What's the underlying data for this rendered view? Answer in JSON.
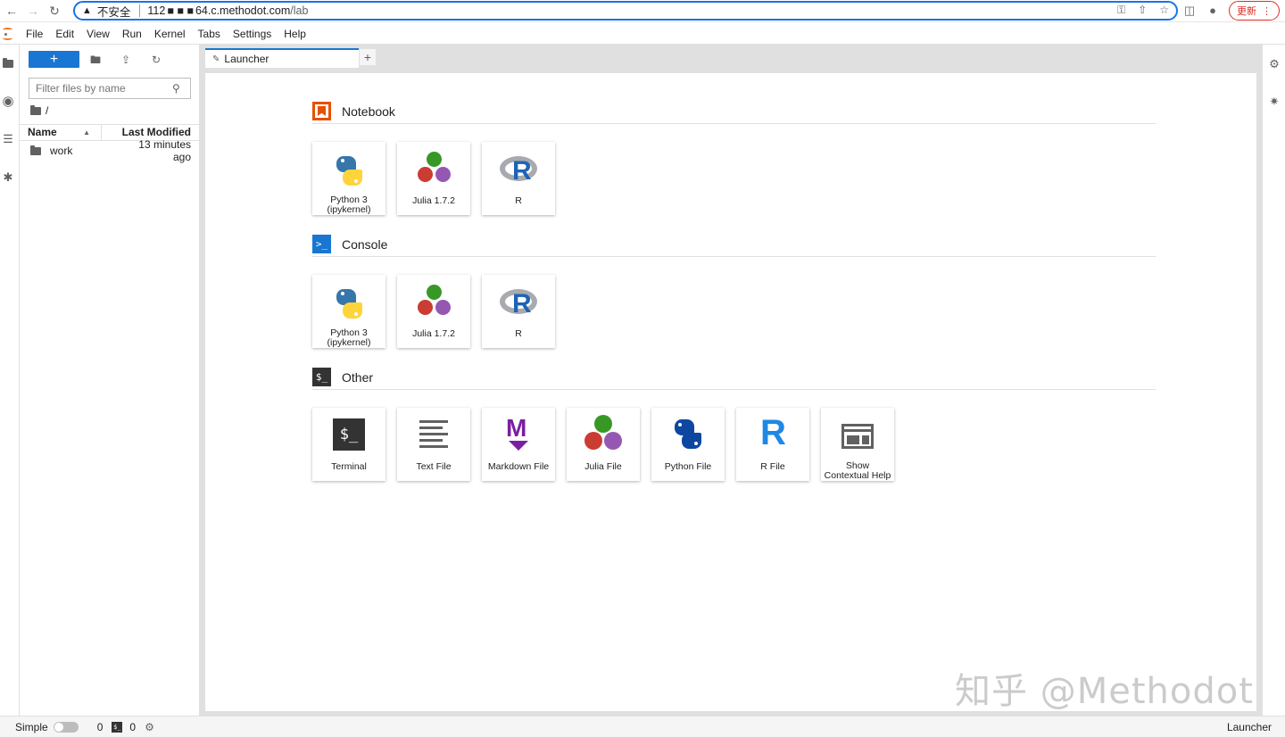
{
  "browser": {
    "security_label": "不安全",
    "url_host_prefix": "112",
    "url_host_suffix": "64.c.methodot.com",
    "url_path": "/lab",
    "update_label": "更新"
  },
  "menu": [
    "File",
    "Edit",
    "View",
    "Run",
    "Kernel",
    "Tabs",
    "Settings",
    "Help"
  ],
  "filebrowser": {
    "new_button": "+",
    "filter_placeholder": "Filter files by name",
    "breadcrumb": "/",
    "columns": {
      "name": "Name",
      "modified": "Last Modified"
    },
    "rows": [
      {
        "name": "work",
        "modified": "13 minutes ago"
      }
    ]
  },
  "tabs": {
    "active": "Launcher",
    "add": "+"
  },
  "launcher": {
    "notebook": {
      "title": "Notebook",
      "items": [
        {
          "label": "Python 3 (ipykernel)",
          "icon": "python-icon"
        },
        {
          "label": "Julia 1.7.2",
          "icon": "julia-icon"
        },
        {
          "label": "R",
          "icon": "r-icon"
        }
      ]
    },
    "console": {
      "title": "Console",
      "items": [
        {
          "label": "Python 3 (ipykernel)",
          "icon": "python-icon"
        },
        {
          "label": "Julia 1.7.2",
          "icon": "julia-icon"
        },
        {
          "label": "R",
          "icon": "r-icon"
        }
      ]
    },
    "other": {
      "title": "Other",
      "items": [
        {
          "label": "Terminal",
          "icon": "terminal-icon"
        },
        {
          "label": "Text File",
          "icon": "text-file-icon"
        },
        {
          "label": "Markdown File",
          "icon": "markdown-icon"
        },
        {
          "label": "Julia File",
          "icon": "julia-icon"
        },
        {
          "label": "Python File",
          "icon": "python-file-icon"
        },
        {
          "label": "R File",
          "icon": "r-file-icon"
        },
        {
          "label": "Show Contextual Help",
          "icon": "contextual-help-icon"
        }
      ]
    }
  },
  "statusbar": {
    "simple_label": "Simple",
    "kernels_count": "0",
    "terminals_count": "0",
    "right_label": "Launcher"
  },
  "watermark": "知乎 @Methodot",
  "colors": {
    "accent": "#1976d2",
    "jupyter_orange": "#f37726",
    "notebook_icon": "#e65100",
    "console_icon": "#1976d2",
    "other_icon": "#333333"
  }
}
